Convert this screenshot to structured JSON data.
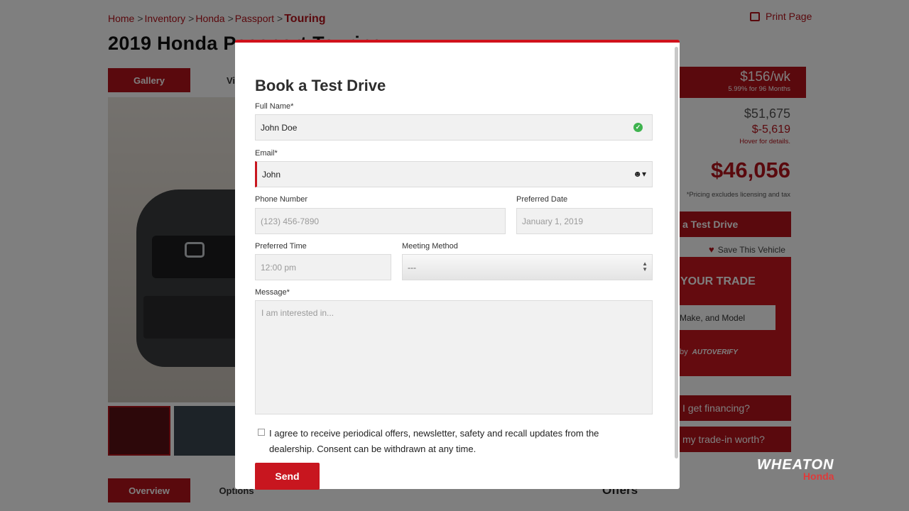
{
  "breadcrumb": {
    "items": [
      "Home",
      "Inventory",
      "Honda",
      "Passport"
    ],
    "current": "Touring",
    "separator": ">"
  },
  "print_label": "Print Page",
  "vehicle_title": "2019 Honda Passport Touring",
  "tabs": {
    "gallery": "Gallery",
    "video": "Vi",
    "overview": "Overview",
    "options": "Options"
  },
  "pricing": {
    "weekly": "$156/wk",
    "weekly_terms": "5.99% for 96 Months",
    "msrp": "$51,675",
    "discount": "$-5,619",
    "hover_note": "Hover for details.",
    "final": "$46,056",
    "note": "*Pricing excludes licensing and tax"
  },
  "sidebar": {
    "test_drive_button": "a Test Drive",
    "save_vehicle": "Save This Vehicle",
    "trade_title": "YOUR TRADE",
    "trade_input": "Make, and Model",
    "trade_by": "by",
    "trade_brand": "AUTOVERIFY",
    "financing_button": "I get financing?",
    "trade_worth_button": "my trade-in worth?",
    "offers_heading": "Offers"
  },
  "dealer": {
    "name": "WHEATON",
    "brand": "Honda"
  },
  "modal": {
    "title": "Book a Test Drive",
    "full_name_label": "Full Name*",
    "full_name_value": "John Doe",
    "email_label": "Email*",
    "email_value": "John",
    "phone_label": "Phone Number",
    "phone_placeholder": "(123) 456-7890",
    "date_label": "Preferred Date",
    "date_placeholder": "January 1, 2019",
    "time_label": "Preferred Time",
    "time_placeholder": "12:00 pm",
    "method_label": "Meeting Method",
    "method_value": "---",
    "message_label": "Message*",
    "message_placeholder": "I am interested in...",
    "consent_text": "I agree to receive periodical offers, newsletter, safety and recall updates from the dealership. Consent can be withdrawn at any time.",
    "send_label": "Send"
  },
  "colors": {
    "accent": "#b5121b",
    "success": "#3fb34f"
  }
}
